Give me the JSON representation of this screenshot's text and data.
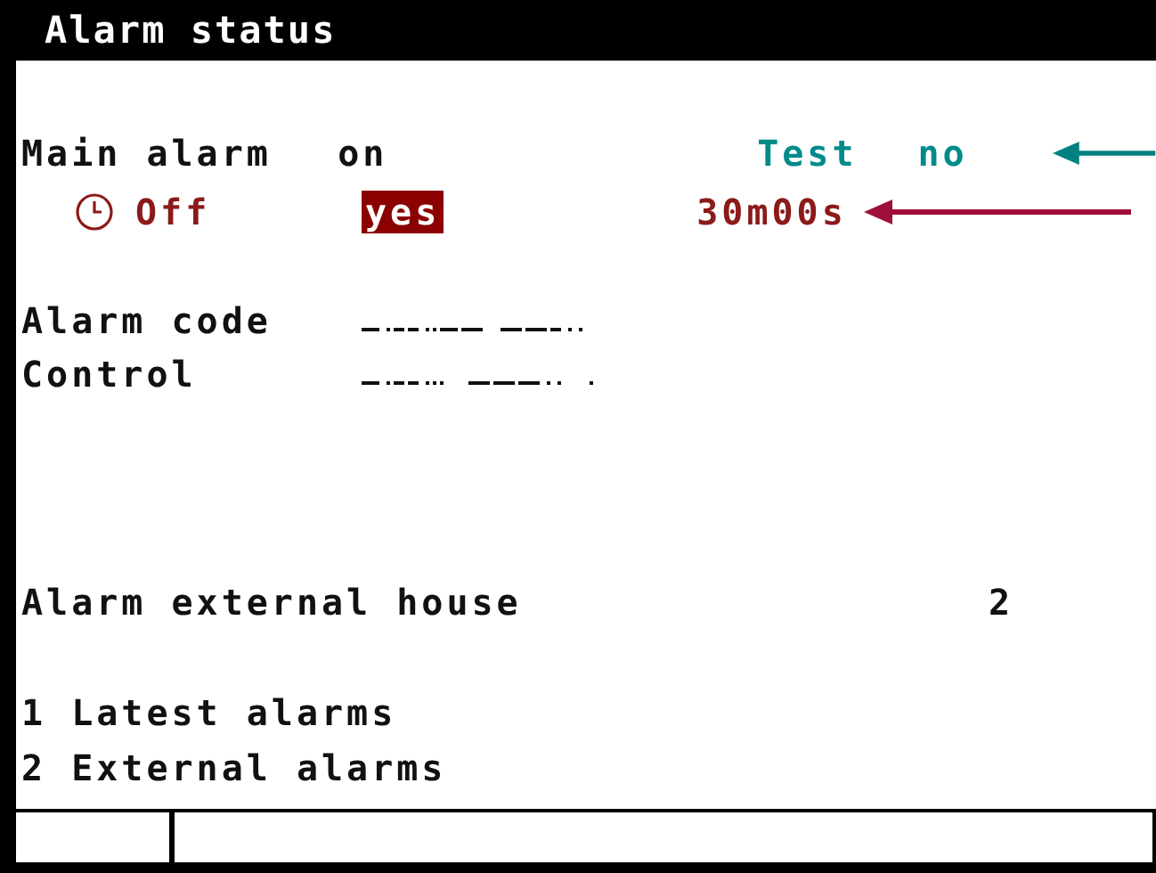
{
  "window": {
    "title": "Alarm status"
  },
  "main_alarm": {
    "label": "Main alarm",
    "value": "on",
    "test_label": "Test",
    "test_value": "no"
  },
  "timer": {
    "state": "Off",
    "confirm": {
      "label": "yes",
      "selected": true
    },
    "duration": "30m00s"
  },
  "fields": [
    {
      "label": "Alarm code"
    },
    {
      "label": "Control"
    }
  ],
  "external": {
    "label": "Alarm external house",
    "value": "2"
  },
  "menu": [
    {
      "label": "1 Latest alarms"
    },
    {
      "label": "2 External alarms"
    }
  ]
}
